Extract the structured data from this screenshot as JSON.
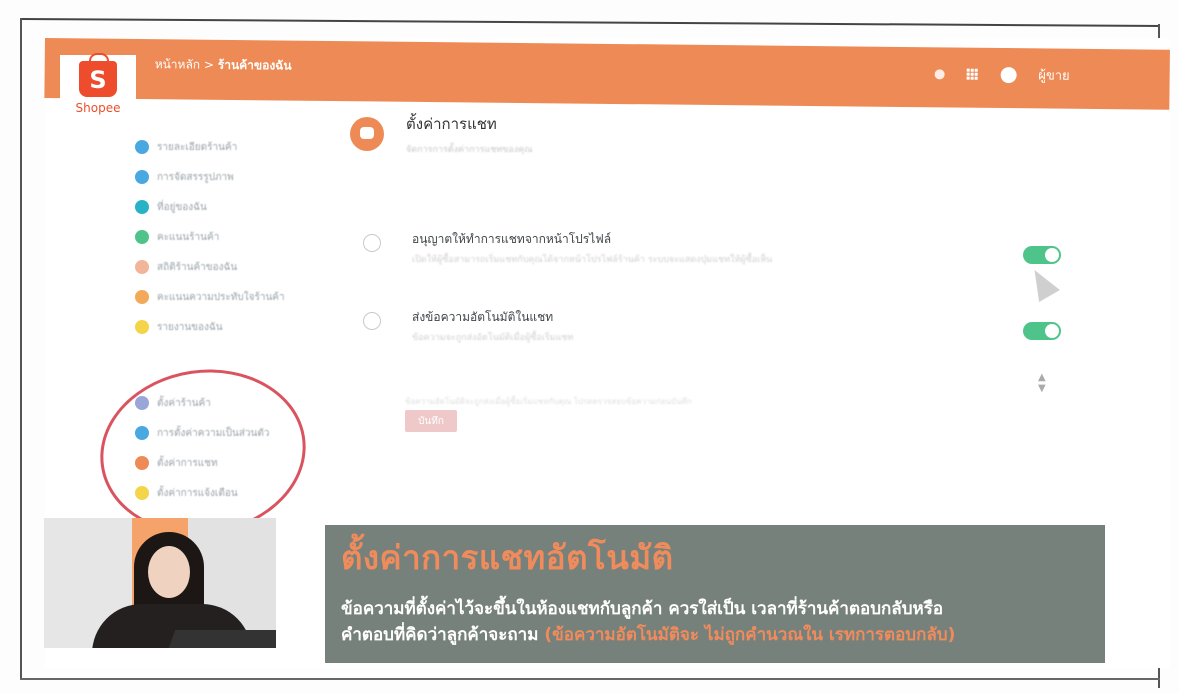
{
  "colors": {
    "brand": "#ee8a55",
    "shopee": "#ee4d2d",
    "toggle_on": "#4fc48a",
    "caption_bg": "#77817c",
    "annotation": "#d9545f"
  },
  "logo": {
    "glyph": "S",
    "name": "Shopee"
  },
  "topbar": {
    "crumb_prefix": "หน้าหลัก >",
    "crumb_current": "ร้านค้าของฉัน",
    "icons": [
      "bell-icon",
      "apps-grid-icon",
      "avatar-icon"
    ],
    "username": "ผู้ขาย"
  },
  "sidebar": {
    "group1": [
      {
        "label": "รายละเอียดร้านค้า",
        "color": "#4aa8e0"
      },
      {
        "label": "การจัดสรรรูปภาพ",
        "color": "#4aa8e0"
      },
      {
        "label": "ที่อยู่ของฉัน",
        "color": "#27b2c6"
      },
      {
        "label": "คะแนนร้านค้า",
        "color": "#4fc48a"
      },
      {
        "label": "สถิติร้านค้าของฉัน",
        "color": "#f2b59a"
      },
      {
        "label": "คะแนนความประทับใจร้านค้า",
        "color": "#f3a95a"
      },
      {
        "label": "รายงานของฉัน",
        "color": "#f4d54a"
      }
    ],
    "group2": [
      {
        "label": "ตั้งค่าร้านค้า",
        "color": "#9aa6d8"
      },
      {
        "label": "การตั้งค่าความเป็นส่วนตัว",
        "color": "#4aa8e0"
      },
      {
        "label": "ตั้งค่าการแชท",
        "color": "#ee8a55"
      },
      {
        "label": "ตั้งค่าการแจ้งเตือน",
        "color": "#f4d54a"
      }
    ]
  },
  "content": {
    "title": "ตั้งค่าการแชท",
    "subtitle": "จัดการการตั้งค่าการแชทของคุณ",
    "settings": [
      {
        "title": "อนุญาตให้ทำการแชทจากหน้าโปรไฟล์",
        "desc": "เปิดให้ผู้ซื้อสามารถเริ่มแชทกับคุณได้จากหน้าโปรไฟล์ร้านค้า ระบบจะแสดงปุ่มแชทให้ผู้ซื้อเห็น",
        "on": true,
        "icon": "chat-bubble-icon"
      },
      {
        "title": "ส่งข้อความอัตโนมัติในแชท",
        "desc": "ข้อความจะถูกส่งอัตโนมัติเมื่อผู้ซื้อเริ่มแชท",
        "on": true,
        "icon": "headset-icon"
      }
    ],
    "note": "ข้อความอัตโนมัติจะถูกส่งเมื่อผู้ซื้อเริ่มแชทกับคุณ โปรดตรวจสอบข้อความก่อนบันทึก",
    "save_label": "บันทึก"
  },
  "caption": {
    "title": "ตั้งค่าการแชทอัตโนมัติ",
    "line1": "ข้อความที่ตั้งค่าไว้จะขึ้นในห้องแชทกับลูกค้า ควรใส่เป็น เวลาที่ร้านค้าตอบกลับหรือ",
    "line2_main": "คำตอบที่คิดว่าลูกค้าจะถาม",
    "line2_highlight": "(ข้อความอัตโนมัติจะ ไม่ถูกคำนวณใน เรทการตอบกลับ)"
  }
}
